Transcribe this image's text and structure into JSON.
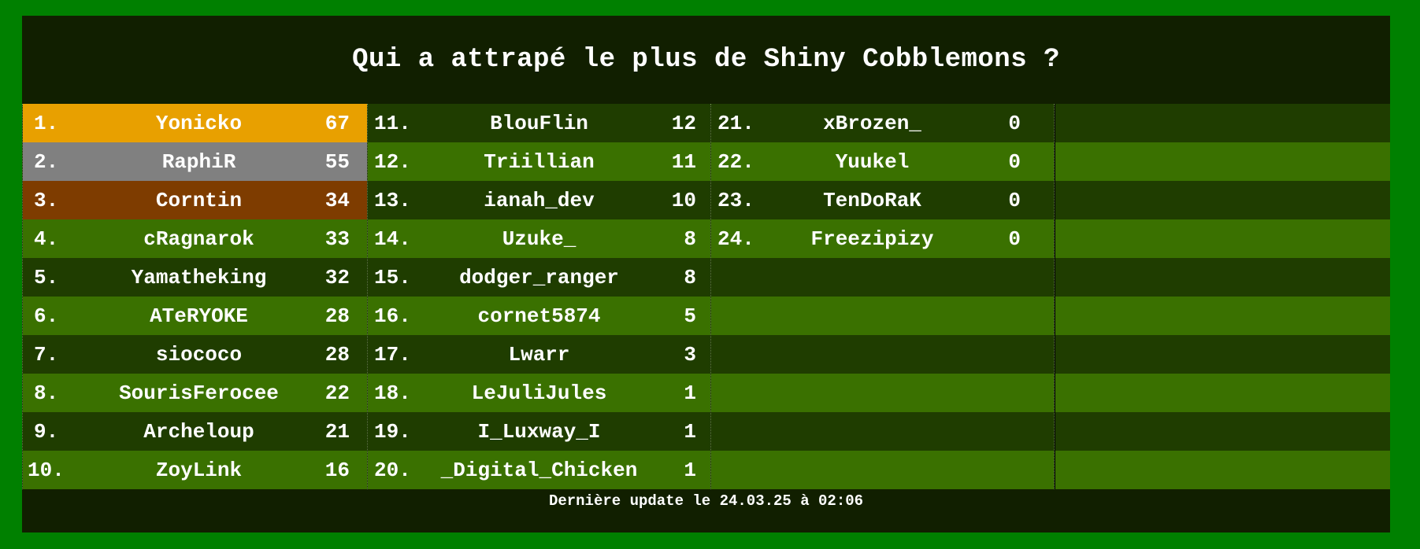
{
  "title": "Qui a attrapé le plus de Shiny Cobblemons ?",
  "footer": "Dernière update le 24.03.25 à 02:06",
  "colors": {
    "outer_border": "#008000",
    "background": "#111f00",
    "row_dark": "#1f3d00",
    "row_light": "#3a7100",
    "gold": "#e8a000",
    "silver": "#808080",
    "bronze": "#7e3c00"
  },
  "columns": [
    [
      {
        "rank": "1.",
        "name": "Yonicko",
        "score": "67"
      },
      {
        "rank": "2.",
        "name": "RaphiR",
        "score": "55"
      },
      {
        "rank": "3.",
        "name": "Corntin",
        "score": "34"
      },
      {
        "rank": "4.",
        "name": "cRagnarok",
        "score": "33"
      },
      {
        "rank": "5.",
        "name": "Yamatheking",
        "score": "32"
      },
      {
        "rank": "6.",
        "name": "ATeRYOKE",
        "score": "28"
      },
      {
        "rank": "7.",
        "name": "siococo",
        "score": "28"
      },
      {
        "rank": "8.",
        "name": "SourisFerocee",
        "score": "22"
      },
      {
        "rank": "9.",
        "name": "Archeloup",
        "score": "21"
      },
      {
        "rank": "10.",
        "name": "ZoyLink",
        "score": "16"
      }
    ],
    [
      {
        "rank": "11.",
        "name": "BlouFlin",
        "score": "12"
      },
      {
        "rank": "12.",
        "name": "Triillian",
        "score": "11"
      },
      {
        "rank": "13.",
        "name": "ianah_dev",
        "score": "10"
      },
      {
        "rank": "14.",
        "name": "Uzuke_",
        "score": "8"
      },
      {
        "rank": "15.",
        "name": "dodger_ranger",
        "score": "8"
      },
      {
        "rank": "16.",
        "name": "cornet5874",
        "score": "5"
      },
      {
        "rank": "17.",
        "name": "Lwarr",
        "score": "3"
      },
      {
        "rank": "18.",
        "name": "LeJuliJules",
        "score": "1"
      },
      {
        "rank": "19.",
        "name": "I_Luxway_I",
        "score": "1"
      },
      {
        "rank": "20.",
        "name": "_Digital_Chicken",
        "score": "1"
      }
    ],
    [
      {
        "rank": "21.",
        "name": "xBrozen_",
        "score": "0"
      },
      {
        "rank": "22.",
        "name": "Yuukel",
        "score": "0"
      },
      {
        "rank": "23.",
        "name": "TenDoRaK",
        "score": "0"
      },
      {
        "rank": "24.",
        "name": "Freezipizy",
        "score": "0"
      },
      {
        "rank": "",
        "name": "",
        "score": ""
      },
      {
        "rank": "",
        "name": "",
        "score": ""
      },
      {
        "rank": "",
        "name": "",
        "score": ""
      },
      {
        "rank": "",
        "name": "",
        "score": ""
      },
      {
        "rank": "",
        "name": "",
        "score": ""
      },
      {
        "rank": "",
        "name": "",
        "score": ""
      }
    ],
    [
      {
        "rank": "",
        "name": "",
        "score": ""
      },
      {
        "rank": "",
        "name": "",
        "score": ""
      },
      {
        "rank": "",
        "name": "",
        "score": ""
      },
      {
        "rank": "",
        "name": "",
        "score": ""
      },
      {
        "rank": "",
        "name": "",
        "score": ""
      },
      {
        "rank": "",
        "name": "",
        "score": ""
      },
      {
        "rank": "",
        "name": "",
        "score": ""
      },
      {
        "rank": "",
        "name": "",
        "score": ""
      },
      {
        "rank": "",
        "name": "",
        "score": ""
      },
      {
        "rank": "",
        "name": "",
        "score": ""
      }
    ]
  ]
}
